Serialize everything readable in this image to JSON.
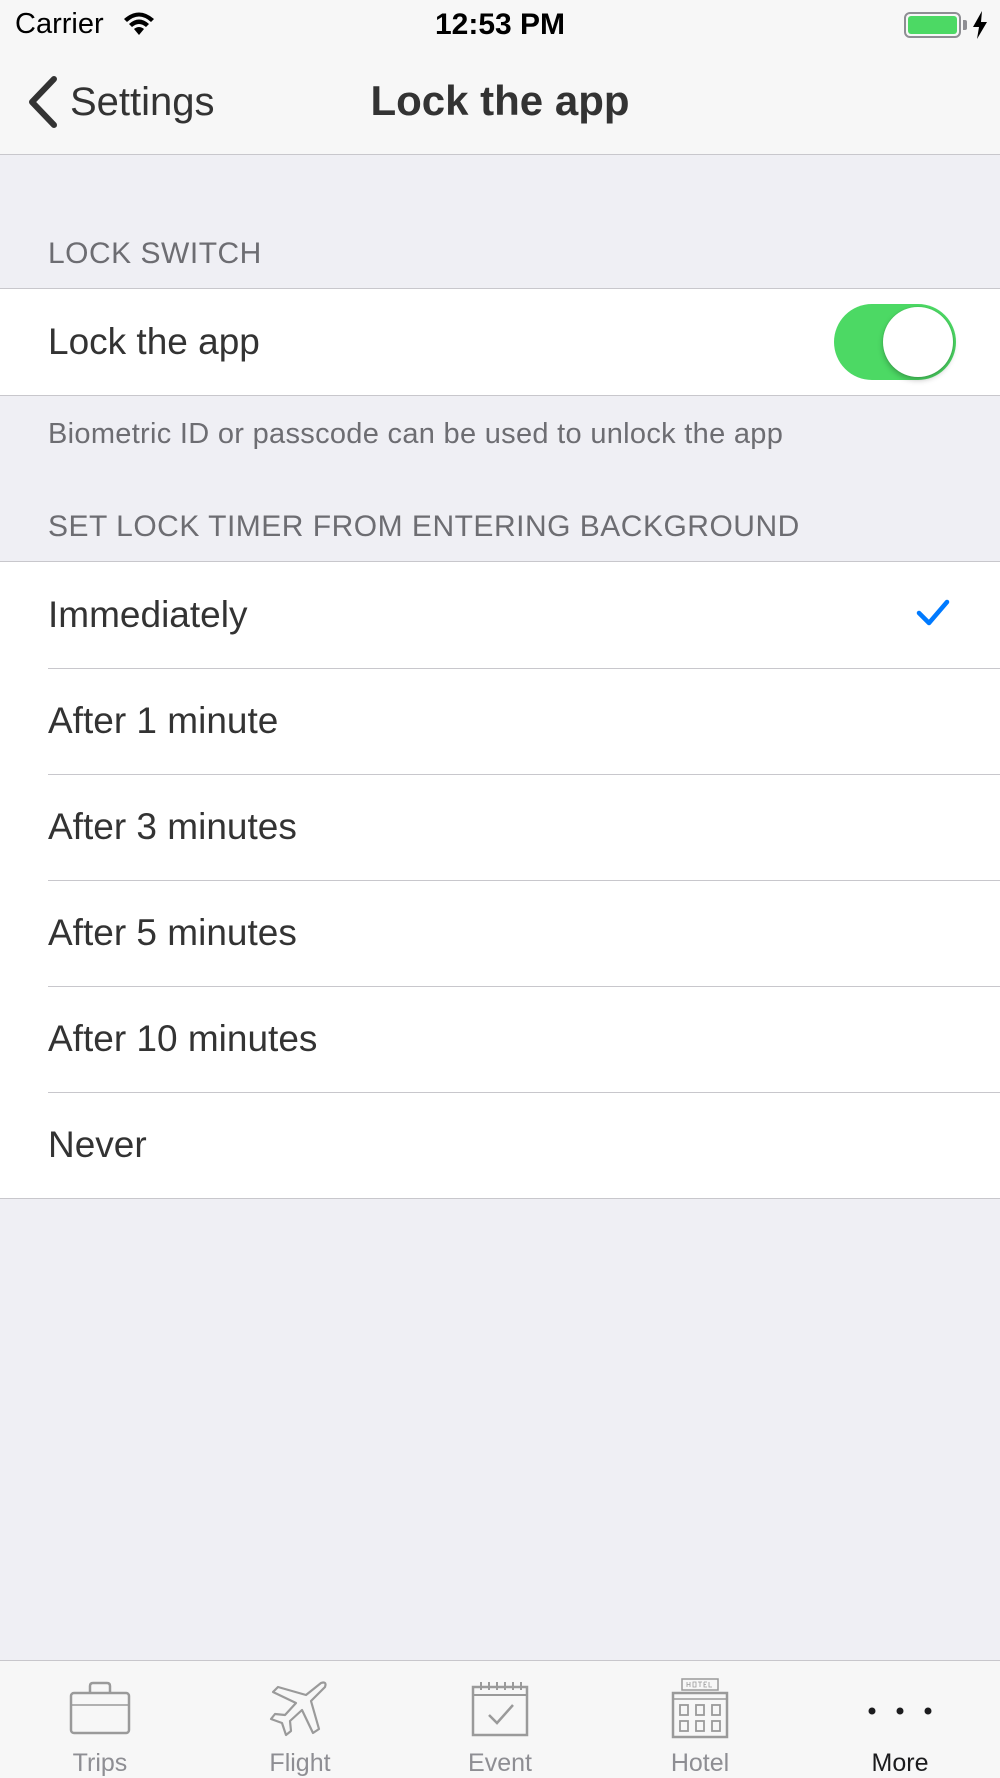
{
  "status_bar": {
    "carrier": "Carrier",
    "time": "12:53 PM"
  },
  "nav": {
    "back_label": "Settings",
    "title": "Lock the app"
  },
  "lock_section": {
    "header": "LOCK SWITCH",
    "row_label": "Lock the app",
    "toggle_on": true,
    "footer": "Biometric ID or passcode can be used to unlock the app"
  },
  "timer_section": {
    "header": "SET LOCK TIMER FROM ENTERING BACKGROUND",
    "options": [
      "Immediately",
      "After 1 minute",
      "After 3 minutes",
      "After 5 minutes",
      "After 10 minutes",
      "Never"
    ],
    "selected": "Immediately"
  },
  "tabs": [
    {
      "label": "Trips",
      "icon": "suitcase-icon"
    },
    {
      "label": "Flight",
      "icon": "airplane-icon"
    },
    {
      "label": "Event",
      "icon": "calendar-check-icon"
    },
    {
      "label": "Hotel",
      "icon": "hotel-icon"
    },
    {
      "label": "More",
      "icon": "more-dots-icon"
    }
  ],
  "active_tab": "More",
  "colors": {
    "toggle_on": "#4cd964",
    "checkmark": "#007aff",
    "background": "#efeff4"
  }
}
